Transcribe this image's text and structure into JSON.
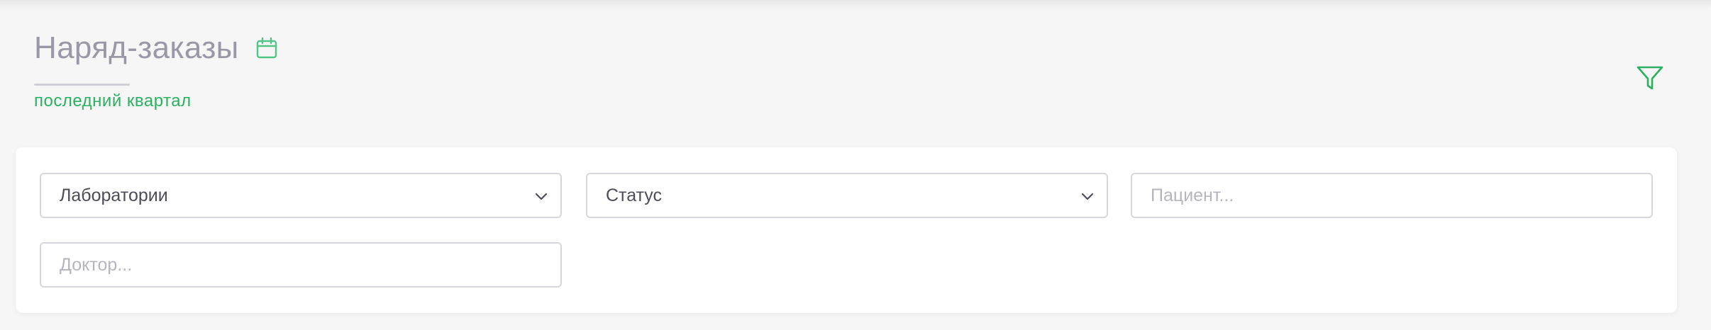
{
  "header": {
    "title": "Наряд-заказы",
    "calendar_icon": "calendar-icon",
    "period": "последний квартал",
    "filter_icon": "filter-icon"
  },
  "filters": {
    "laboratories": {
      "selected": "Лаборатории",
      "icon": "chevron-down-icon"
    },
    "status": {
      "selected": "Статус",
      "icon": "chevron-down-icon"
    },
    "patient": {
      "value": "",
      "placeholder": "Пациент..."
    },
    "doctor": {
      "value": "",
      "placeholder": "Доктор..."
    }
  },
  "colors": {
    "accent": "#2ab05f",
    "title": "#9a98a6",
    "background": "#f6f6f6",
    "card": "#ffffff",
    "border": "#d6d6dc"
  }
}
